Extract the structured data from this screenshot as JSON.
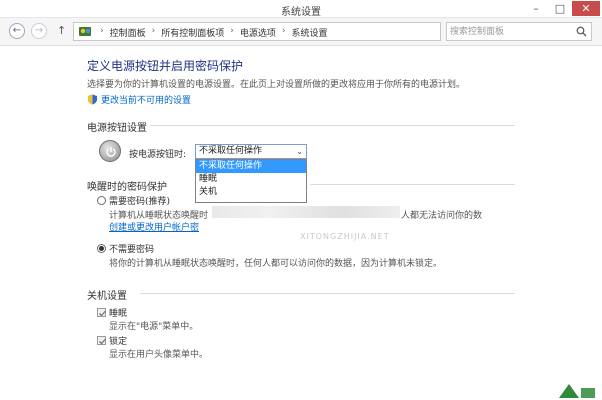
{
  "window": {
    "title": "系统设置"
  },
  "nav": {
    "breadcrumbs": [
      "控制面板",
      "所有控制面板项",
      "电源选项",
      "系统设置"
    ],
    "search_placeholder": "搜索控制面板"
  },
  "page": {
    "title": "定义电源按钮并启用密码保护",
    "description": "选择要为你的计算机设置的电源设置。在此页上对设置所做的更改将应用于你所有的电源计划。",
    "change_link": "更改当前不可用的设置"
  },
  "power_button": {
    "section_title": "电源按钮设置",
    "label": "按电源按钮时:",
    "selected_value": "不采取任何操作",
    "options": [
      "不采取任何操作",
      "睡眠",
      "关机"
    ]
  },
  "password": {
    "section_title": "唤醒时的密码保护",
    "require": {
      "label": "需要密码(推荐)",
      "desc_start": "计算机从睡眠状态唤醒时",
      "desc_end": "人都无法访问你的数",
      "link": "创建或更改用户帐户密"
    },
    "no_require": {
      "label": "不需要密码",
      "desc": "将你的计算机从睡眠状态唤醒时，任何人都可以访问你的数据，因为计算机未锁定。"
    },
    "selected": "no_require"
  },
  "shutdown": {
    "section_title": "关机设置",
    "items": [
      {
        "label": "睡眠",
        "desc": "显示在\"电源\"菜单中。",
        "checked": true
      },
      {
        "label": "锁定",
        "desc": "显示在用户头像菜单中。",
        "checked": true
      }
    ]
  },
  "watermark": "XITONGZHIJIA.NET",
  "colors": {
    "heading": "#1e3287",
    "link": "#0066cc",
    "highlight": "#3399ff",
    "close_button": "#c94c4c"
  }
}
